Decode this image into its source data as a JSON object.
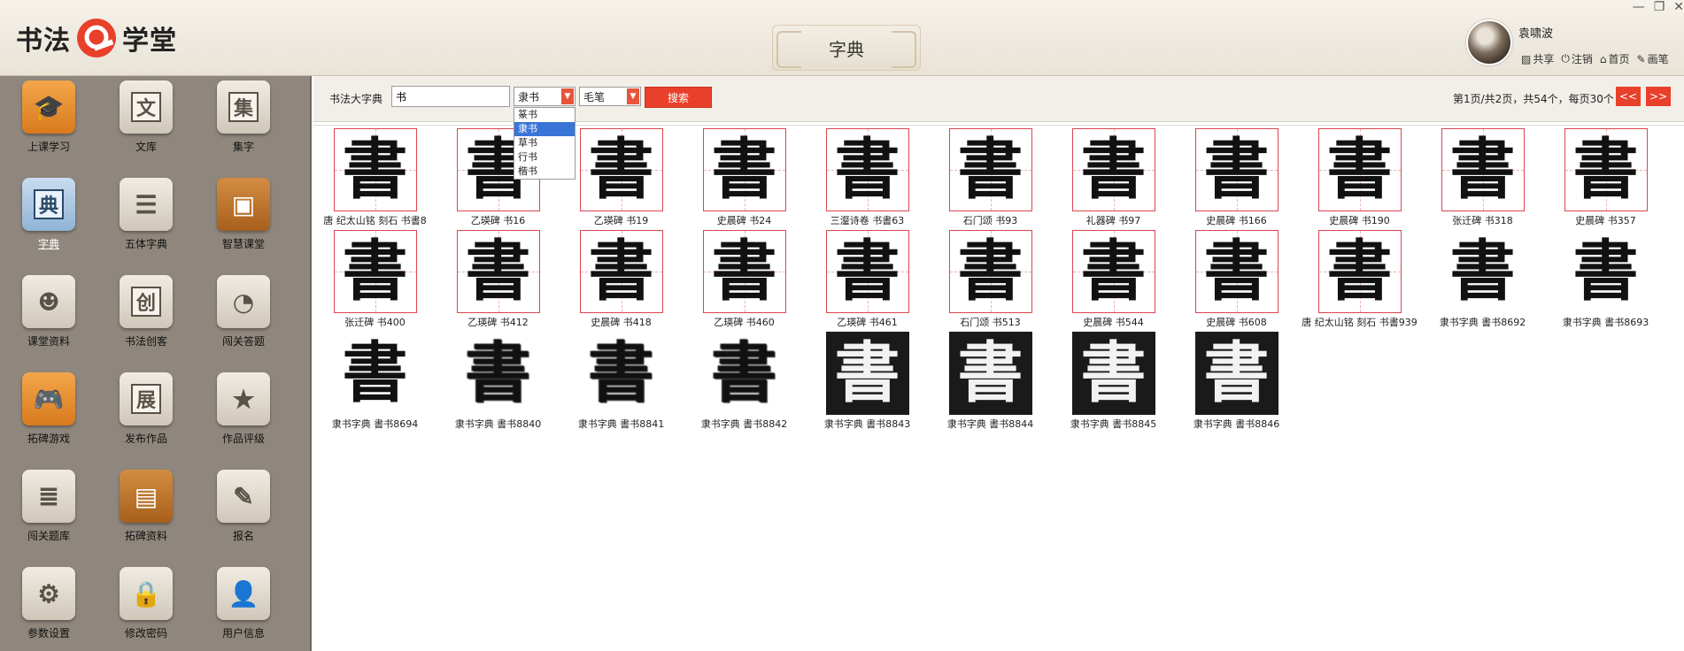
{
  "app": {
    "logo_left": "书法",
    "logo_right": "学堂",
    "page_title": "字典"
  },
  "user": {
    "name": "袁啸波",
    "links": [
      "共享",
      "注销",
      "首页",
      "画笔"
    ]
  },
  "window": {
    "minimize": "—",
    "restore": "❐",
    "close": "✕"
  },
  "sidebar": {
    "items": [
      {
        "label": "上课学习",
        "icon": "mortarboard-icon",
        "glyph": "🎓",
        "style": "orange",
        "active": false
      },
      {
        "label": "文库",
        "icon": "wen-character-icon",
        "glyph": "文",
        "style": "gray",
        "boxed": true,
        "active": false
      },
      {
        "label": "集字",
        "icon": "ji-character-icon",
        "glyph": "集",
        "style": "gray",
        "boxed": true,
        "active": false
      },
      {
        "label": "字典",
        "icon": "dian-character-icon",
        "glyph": "典",
        "style": "blue",
        "boxed": true,
        "active": true
      },
      {
        "label": "五体字典",
        "icon": "notebook-icon",
        "glyph": "☰",
        "style": "gray",
        "active": false
      },
      {
        "label": "智慧课堂",
        "icon": "easel-icon",
        "glyph": "▣",
        "style": "brown",
        "active": false
      },
      {
        "label": "课堂资料",
        "icon": "users-icon",
        "glyph": "☻",
        "style": "gray",
        "active": false
      },
      {
        "label": "书法创客",
        "icon": "chuang-character-icon",
        "glyph": "创",
        "style": "gray",
        "boxed": true,
        "active": false
      },
      {
        "label": "闯关答题",
        "icon": "gauge-icon",
        "glyph": "◔",
        "style": "gray",
        "active": false
      },
      {
        "label": "拓碑游戏",
        "icon": "gamepad-icon",
        "glyph": "🎮",
        "style": "orange",
        "active": false
      },
      {
        "label": "发布作品",
        "icon": "zhan-character-icon",
        "glyph": "展",
        "style": "gray",
        "boxed": true,
        "active": false
      },
      {
        "label": "作品评级",
        "icon": "star-icon",
        "glyph": "★",
        "style": "gray",
        "active": false
      },
      {
        "label": "闯关题库",
        "icon": "layers-icon",
        "glyph": "≣",
        "style": "gray",
        "active": false
      },
      {
        "label": "拓碑资料",
        "icon": "book-icon",
        "glyph": "▤",
        "style": "brown",
        "active": false
      },
      {
        "label": "报名",
        "icon": "edit-icon",
        "glyph": "✎",
        "style": "gray",
        "active": false
      },
      {
        "label": "参数设置",
        "icon": "gear-icon",
        "glyph": "⚙",
        "style": "gray",
        "active": false
      },
      {
        "label": "修改密码",
        "icon": "lock-icon",
        "glyph": "🔒",
        "style": "gray",
        "active": false
      },
      {
        "label": "用户信息",
        "icon": "user-icon",
        "glyph": "👤",
        "style": "gray",
        "active": false
      }
    ]
  },
  "search": {
    "label": "书法大字典",
    "query": "书",
    "script_select": "隶书",
    "script_options": [
      "篆书",
      "隶书",
      "草书",
      "行书",
      "楷书"
    ],
    "tool_select": "毛笔",
    "button": "搜索"
  },
  "pagination": {
    "info": "第1页/共2页，共54个，每页30个",
    "prev": "<<",
    "next": ">>"
  },
  "results": [
    {
      "caption": "唐 纪太山铭 刻石 书書8",
      "glyph": "書",
      "style": "grid"
    },
    {
      "caption": "乙瑛碑 书16",
      "glyph": "書",
      "style": "grid"
    },
    {
      "caption": "乙瑛碑 书19",
      "glyph": "書",
      "style": "grid"
    },
    {
      "caption": "史晨碑 书24",
      "glyph": "書",
      "style": "grid"
    },
    {
      "caption": "三瀣诗卷 书書63",
      "glyph": "書",
      "style": "grid"
    },
    {
      "caption": "石门颂 书93",
      "glyph": "書",
      "style": "grid"
    },
    {
      "caption": "礼器碑 书97",
      "glyph": "書",
      "style": "grid"
    },
    {
      "caption": "史晨碑 书166",
      "glyph": "書",
      "style": "grid"
    },
    {
      "caption": "史晨碑 书190",
      "glyph": "書",
      "style": "grid"
    },
    {
      "caption": "张迁碑 书318",
      "glyph": "書",
      "style": "grid"
    },
    {
      "caption": "史晨碑 书357",
      "glyph": "書",
      "style": "grid"
    },
    {
      "caption": "张迁碑 书400",
      "glyph": "書",
      "style": "grid"
    },
    {
      "caption": "乙瑛碑 书412",
      "glyph": "書",
      "style": "grid"
    },
    {
      "caption": "史晨碑 书418",
      "glyph": "書",
      "style": "grid"
    },
    {
      "caption": "乙瑛碑 书460",
      "glyph": "書",
      "style": "grid"
    },
    {
      "caption": "乙瑛碑 书461",
      "glyph": "書",
      "style": "grid"
    },
    {
      "caption": "石门颂 书513",
      "glyph": "書",
      "style": "grid"
    },
    {
      "caption": "史晨碑 书544",
      "glyph": "書",
      "style": "grid"
    },
    {
      "caption": "史晨碑 书608",
      "glyph": "書",
      "style": "grid"
    },
    {
      "caption": "唐 纪太山铭 刻石 书書939",
      "glyph": "書",
      "style": "grid"
    },
    {
      "caption": "隶书字典 書书8692",
      "glyph": "書",
      "style": "plain"
    },
    {
      "caption": "隶书字典 書书8693",
      "glyph": "書",
      "style": "plain"
    },
    {
      "caption": "隶书字典 書书8694",
      "glyph": "書",
      "style": "plain"
    },
    {
      "caption": "隶书字典 書书8840",
      "glyph": "書",
      "style": "rubbing"
    },
    {
      "caption": "隶书字典 書书8841",
      "glyph": "書",
      "style": "rubbing"
    },
    {
      "caption": "隶书字典 書书8842",
      "glyph": "書",
      "style": "rubbing"
    },
    {
      "caption": "隶书字典 書书8843",
      "glyph": "書",
      "style": "dark"
    },
    {
      "caption": "隶书字典 書书8844",
      "glyph": "書",
      "style": "dark"
    },
    {
      "caption": "隶书字典 書书8845",
      "glyph": "書",
      "style": "dark"
    },
    {
      "caption": "隶书字典 書书8846",
      "glyph": "書",
      "style": "dark"
    }
  ],
  "colors": {
    "accent_red": "#e8402a",
    "sidebar_bg": "#8f877d",
    "grid_red": "#d9464f"
  }
}
